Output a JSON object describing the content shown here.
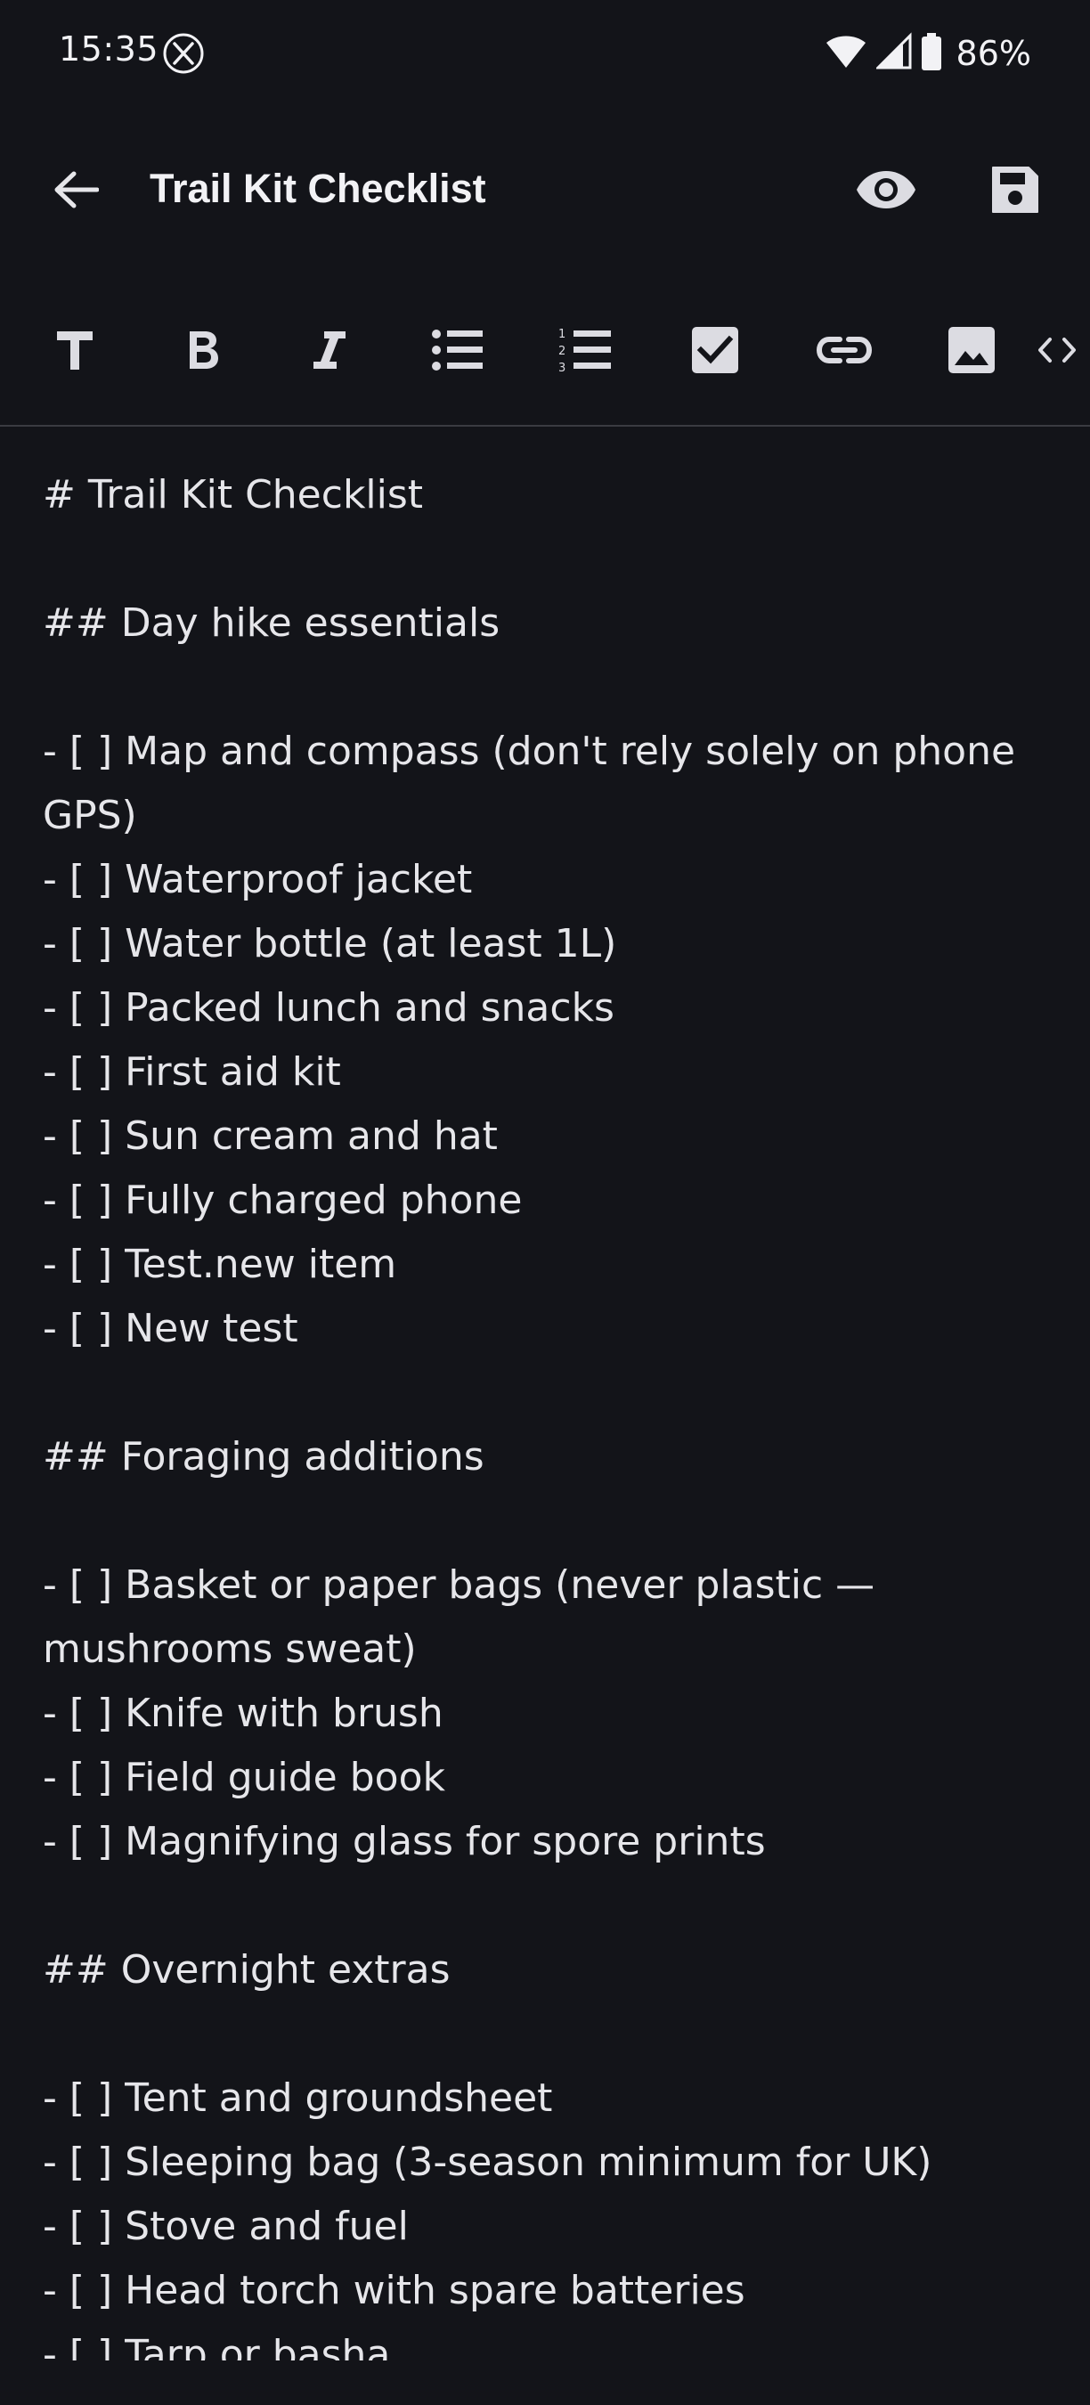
{
  "status_bar": {
    "time": "15:35",
    "battery": "86%"
  },
  "app_bar": {
    "title": "Trail Kit Checklist"
  },
  "editor": {
    "lines": [
      "# Trail Kit Checklist",
      "",
      "## Day hike essentials",
      "",
      "- [ ] Map and compass (don't rely solely on phone",
      "GPS)",
      "- [ ] Waterproof jacket",
      "- [ ] Water bottle (at least 1L)",
      "- [ ] Packed lunch and snacks",
      "- [ ] First aid kit",
      "- [ ] Sun cream and hat",
      "- [ ] Fully charged phone",
      "- [ ] Test.new item",
      "- [ ] New test",
      "",
      "## Foraging additions",
      "",
      "- [ ] Basket or paper bags (never plastic —",
      "mushrooms sweat)",
      "- [ ] Knife with brush",
      "- [ ] Field guide book",
      "- [ ] Magnifying glass for spore prints",
      "",
      "## Overnight extras",
      "",
      "- [ ] Tent and groundsheet",
      "- [ ] Sleeping bag (3-season minimum for UK)",
      "- [ ] Stove and fuel",
      "- [ ] Head torch with spare batteries",
      "- [ ] Tarp or basha"
    ]
  },
  "colors": {
    "background": "#131419",
    "text": "#e6e6ea",
    "icon": "#dcdce2",
    "divider": "#3a3b41"
  }
}
